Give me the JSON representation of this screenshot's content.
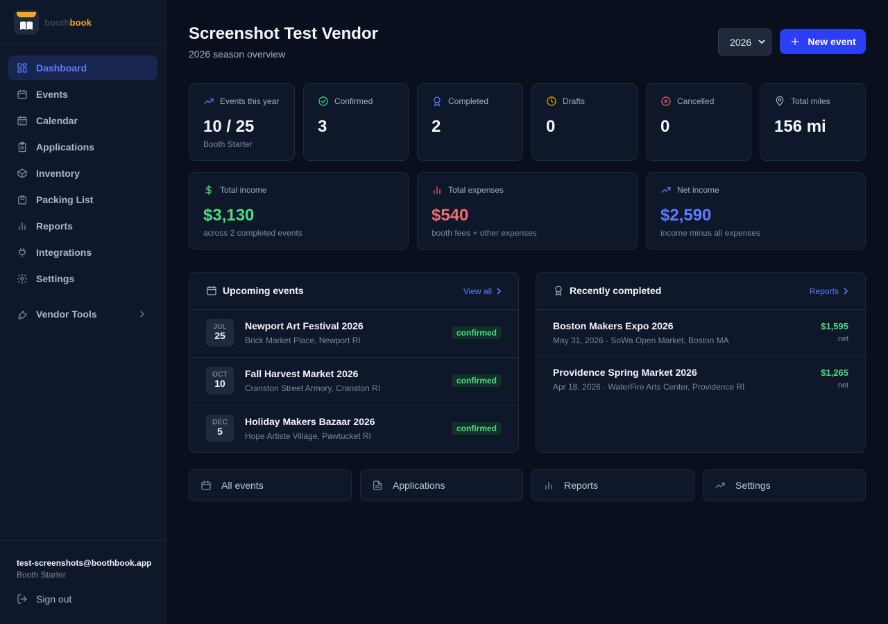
{
  "brand": {
    "part1": "booth",
    "part2": "book"
  },
  "sidebar": {
    "items": [
      {
        "label": "Dashboard",
        "icon": "dashboard-icon",
        "active": true
      },
      {
        "label": "Events",
        "icon": "calendar-icon"
      },
      {
        "label": "Calendar",
        "icon": "calendar-grid-icon"
      },
      {
        "label": "Applications",
        "icon": "clipboard-icon"
      },
      {
        "label": "Inventory",
        "icon": "box-icon"
      },
      {
        "label": "Packing List",
        "icon": "bag-icon"
      },
      {
        "label": "Reports",
        "icon": "bar-chart-icon"
      },
      {
        "label": "Integrations",
        "icon": "plug-icon"
      },
      {
        "label": "Settings",
        "icon": "gear-icon"
      }
    ],
    "vendor_tools": "Vendor Tools",
    "user_email": "test-screenshots@boothbook.app",
    "user_plan": "Booth Starter",
    "sign_out": "Sign out"
  },
  "header": {
    "title": "Screenshot Test Vendor",
    "subtitle": "2026 season overview",
    "year": "2026",
    "new_event": "New event"
  },
  "stats": [
    {
      "label": "Events this year",
      "value": "10 / 25",
      "note": "Booth Starter",
      "icon": "trend-up-icon",
      "color": "#5b7cff"
    },
    {
      "label": "Confirmed",
      "value": "3",
      "note": "",
      "icon": "check-circle-icon",
      "color": "#4ade80"
    },
    {
      "label": "Completed",
      "value": "2",
      "note": "",
      "icon": "award-icon",
      "color": "#5b7cff"
    },
    {
      "label": "Drafts",
      "value": "0",
      "note": "",
      "icon": "clock-icon",
      "color": "#f5b400"
    },
    {
      "label": "Cancelled",
      "value": "0",
      "note": "",
      "icon": "x-circle-icon",
      "color": "#f26d6d"
    },
    {
      "label": "Total miles",
      "value": "156 mi",
      "note": "",
      "icon": "map-pin-icon",
      "color": "#aeb8c9"
    }
  ],
  "money": [
    {
      "label": "Total income",
      "value": "$3,130",
      "note": "across 2 completed events",
      "icon": "dollar-icon",
      "color": "#4ade80"
    },
    {
      "label": "Total expenses",
      "value": "$540",
      "note": "booth fees + other expenses",
      "icon": "bar-chart-icon",
      "color": "#f26d6d"
    },
    {
      "label": "Net income",
      "value": "$2,590",
      "note": "income minus all expenses",
      "icon": "trend-up-icon",
      "color": "#5b7cff"
    }
  ],
  "upcoming": {
    "title": "Upcoming events",
    "link": "View all",
    "events": [
      {
        "month": "JUL",
        "day": "25",
        "name": "Newport Art Festival 2026",
        "place": "Brick Market Place, Newport RI",
        "status": "confirmed"
      },
      {
        "month": "OCT",
        "day": "10",
        "name": "Fall Harvest Market 2026",
        "place": "Cranston Street Armory, Cranston RI",
        "status": "confirmed"
      },
      {
        "month": "DEC",
        "day": "5",
        "name": "Holiday Makers Bazaar 2026",
        "place": "Hope Artiste Village, Pawtucket RI",
        "status": "confirmed"
      }
    ]
  },
  "completed": {
    "title": "Recently completed",
    "link": "Reports",
    "events": [
      {
        "name": "Boston Makers Expo 2026",
        "meta": "May 31, 2026 · SoWa Open Market, Boston MA",
        "amount": "$1,595",
        "unit": "net"
      },
      {
        "name": "Providence Spring Market 2026",
        "meta": "Apr 18, 2026 · WaterFire Arts Center, Providence RI",
        "amount": "$1,265",
        "unit": "net"
      }
    ]
  },
  "quick_links": [
    {
      "label": "All events",
      "icon": "calendar-icon"
    },
    {
      "label": "Applications",
      "icon": "file-icon"
    },
    {
      "label": "Reports",
      "icon": "bar-chart-icon"
    },
    {
      "label": "Settings",
      "icon": "trend-up-icon"
    }
  ]
}
